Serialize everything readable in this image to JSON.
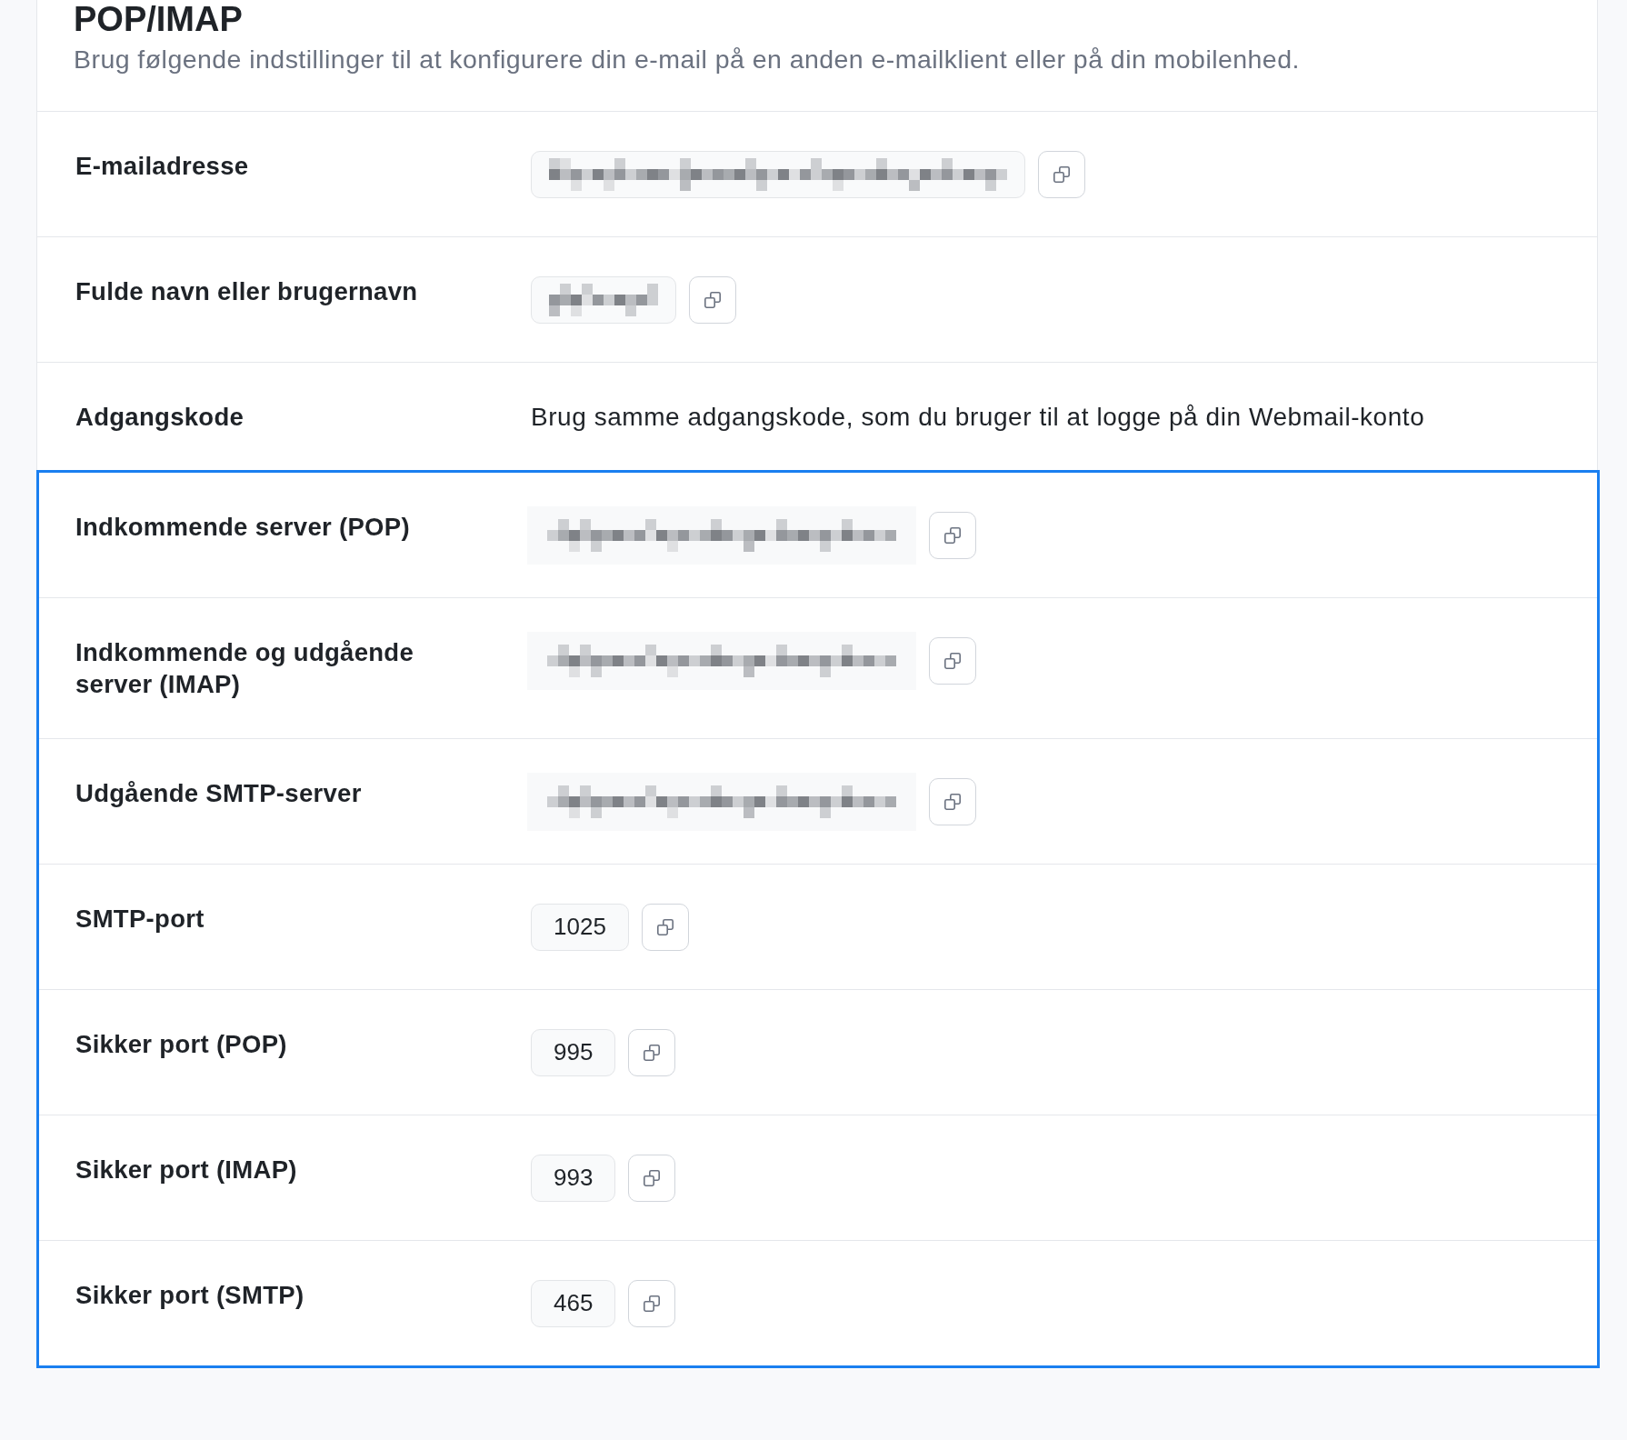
{
  "header": {
    "title": "POP/IMAP",
    "subtitle": "Brug følgende indstillinger til at konfigurere din e-mail på en anden e-mailklient eller på din mobilenhed."
  },
  "sections": [
    {
      "highlighted": false,
      "rows": [
        {
          "label": "E-mailadresse",
          "kind": "masked"
        },
        {
          "label": "Fulde navn eller brugernavn",
          "kind": "masked"
        },
        {
          "label": "Adgangskode",
          "kind": "text",
          "value": "Brug samme adgangskode, som du bruger til at logge på din Webmail-konto"
        }
      ]
    },
    {
      "highlighted": true,
      "rows": [
        {
          "label": "Indkommende server (POP)",
          "kind": "blurred"
        },
        {
          "label": "Indkommende og udgående server (IMAP)",
          "kind": "blurred"
        },
        {
          "label": "Udgående SMTP-server",
          "kind": "blurred"
        },
        {
          "label": "SMTP-port",
          "kind": "field",
          "value": "1025"
        },
        {
          "label": "Sikker port (POP)",
          "kind": "field",
          "value": "995"
        },
        {
          "label": "Sikker port (IMAP)",
          "kind": "field",
          "value": "993"
        },
        {
          "label": "Sikker port (SMTP)",
          "kind": "field",
          "value": "465"
        }
      ]
    }
  ]
}
